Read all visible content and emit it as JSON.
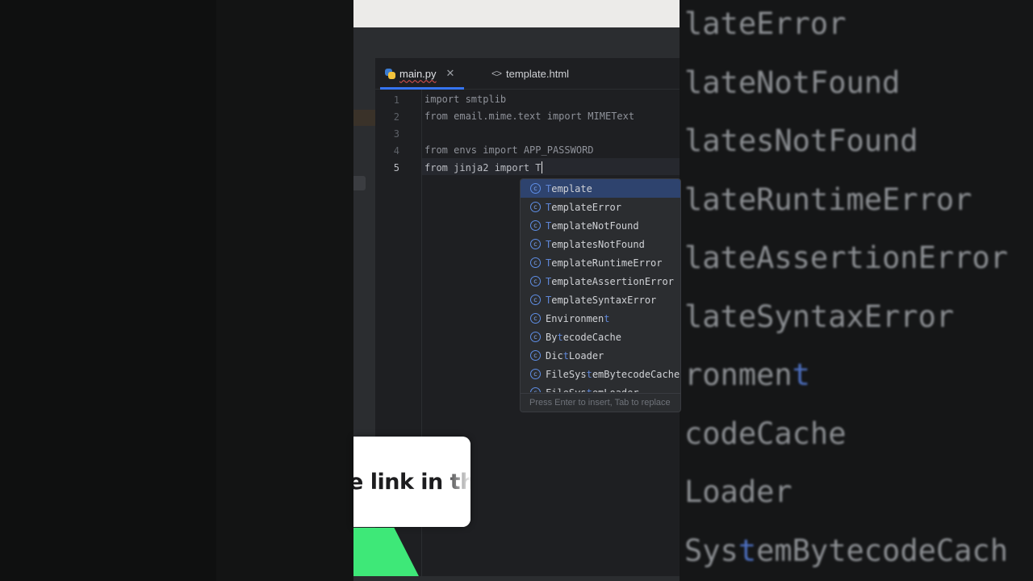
{
  "background": {
    "right_lines": [
      {
        "pre": "lateError",
        "hl": "",
        "post": ""
      },
      {
        "pre": "lateNotFound",
        "hl": "",
        "post": ""
      },
      {
        "pre": "latesNotFound",
        "hl": "",
        "post": ""
      },
      {
        "pre": "lateRuntimeError",
        "hl": "",
        "post": ""
      },
      {
        "pre": "lateAssertionError",
        "hl": "",
        "post": ""
      },
      {
        "pre": "lateSyntaxError",
        "hl": "",
        "post": ""
      },
      {
        "pre": "ronmen",
        "hl": "t",
        "post": ""
      },
      {
        "pre": "codeCache",
        "hl": "",
        "post": ""
      },
      {
        "pre": "Loader",
        "hl": "",
        "post": ""
      },
      {
        "pre": "Sys",
        "hl": "t",
        "post": "emBytecodeCach"
      }
    ]
  },
  "tabs": {
    "main": "main.py",
    "template": "template.html"
  },
  "editor": {
    "line_numbers": [
      "1",
      "2",
      "3",
      "4",
      "5"
    ],
    "lines": [
      "import smtplib",
      "from email.mime.text import MIMEText",
      "",
      "from envs import APP_PASSWORD",
      "from jinja2 import T"
    ]
  },
  "completion": {
    "items": [
      {
        "pre": "",
        "hl": "T",
        "post": "emplate"
      },
      {
        "pre": "",
        "hl": "T",
        "post": "emplateError"
      },
      {
        "pre": "",
        "hl": "T",
        "post": "emplateNotFound"
      },
      {
        "pre": "",
        "hl": "T",
        "post": "emplatesNotFound"
      },
      {
        "pre": "",
        "hl": "T",
        "post": "emplateRuntimeError"
      },
      {
        "pre": "",
        "hl": "T",
        "post": "emplateAssertionError"
      },
      {
        "pre": "",
        "hl": "T",
        "post": "emplateSyntaxError"
      },
      {
        "pre": "Environmen",
        "hl": "t",
        "post": ""
      },
      {
        "pre": "By",
        "hl": "t",
        "post": "ecodeCache"
      },
      {
        "pre": "Dic",
        "hl": "t",
        "post": "Loader"
      },
      {
        "pre": "FileSys",
        "hl": "t",
        "post": "emBytecodeCache"
      },
      {
        "pre": "FileSys",
        "hl": "t",
        "post": "emLoader"
      }
    ],
    "icon_letter": "c",
    "footer": "Press Enter to insert, Tab to replace"
  },
  "caption": {
    "text": "e link in the"
  },
  "colors": {
    "accent": "#3574f0",
    "match_highlight": "#5f86d6",
    "green": "#3ee878"
  }
}
